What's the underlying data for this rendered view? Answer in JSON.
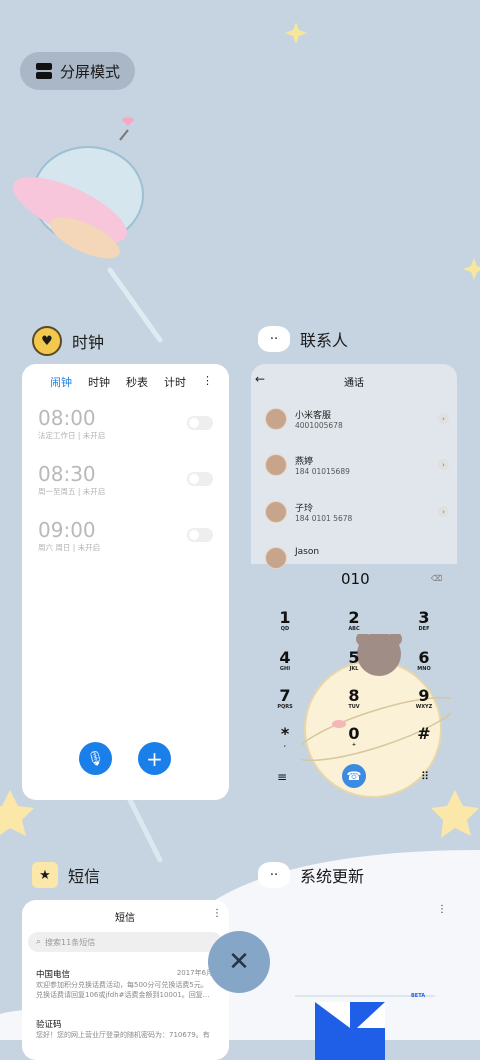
{
  "split_mode": {
    "label": "分屏模式"
  },
  "apps": {
    "clock": {
      "label": "时钟"
    },
    "contacts": {
      "label": "联系人"
    },
    "sms": {
      "label": "短信"
    },
    "update": {
      "label": "系统更新"
    }
  },
  "clock": {
    "tabs": [
      "闹钟",
      "时钟",
      "秒表",
      "计时"
    ],
    "alarms": [
      {
        "time": "08:00",
        "sub": "法定工作日 | 未开启",
        "on": false
      },
      {
        "time": "08:30",
        "sub": "周一至周五 | 未开启",
        "on": false
      },
      {
        "time": "09:00",
        "sub": "周六 周日 | 未开启",
        "on": false
      }
    ]
  },
  "contacts": {
    "title": "通话",
    "list": [
      {
        "name": "小米客服",
        "number": "4001005678"
      },
      {
        "name": "燕婷",
        "number": "184 01015689"
      },
      {
        "name": "子玲",
        "number": "184 0101 5678"
      },
      {
        "name": "Jason",
        "number": ""
      }
    ],
    "dial_input": "010",
    "keys": [
      {
        "d": "1",
        "l": "QD"
      },
      {
        "d": "2",
        "l": "ABC"
      },
      {
        "d": "3",
        "l": "DEF"
      },
      {
        "d": "4",
        "l": "GHI"
      },
      {
        "d": "5",
        "l": "JKL"
      },
      {
        "d": "6",
        "l": "MNO"
      },
      {
        "d": "7",
        "l": "PQRS"
      },
      {
        "d": "8",
        "l": "TUV"
      },
      {
        "d": "9",
        "l": "WXYZ"
      },
      {
        "d": "*",
        "l": ","
      },
      {
        "d": "0",
        "l": "+"
      },
      {
        "d": "#",
        "l": ""
      }
    ]
  },
  "sms": {
    "title": "短信",
    "search_placeholder": "搜索11条短信",
    "messages": [
      {
        "sender": "中国电信",
        "date": "2017年6月30",
        "preview1": "欢迎参加积分兑换话费活动，每500分可兑换话费5元。",
        "preview2": "兑换话费请回复106或jfdh#话费金额到10001。回复..."
      },
      {
        "sender": "验证码",
        "date": "",
        "preview1": "您好！您的网上营业厅登录的随机密码为：710679。有",
        "preview2": ""
      }
    ]
  },
  "update": {
    "badge": "BETA"
  },
  "colors": {
    "accent": "#1a7fe8",
    "background": "#c6d3e0",
    "close_button": "#86a6c8"
  }
}
